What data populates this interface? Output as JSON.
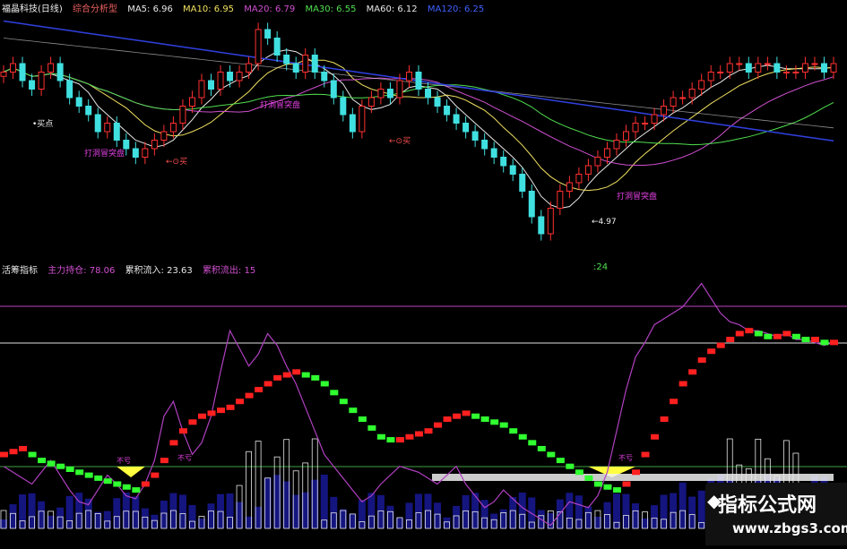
{
  "top_header": {
    "title": "福晶科技(日线)",
    "indicator": "综合分析型",
    "ma": [
      {
        "label": "MA5: 6.96",
        "color": "#e8e8e8"
      },
      {
        "label": "MA10: 6.95",
        "color": "#f0e060"
      },
      {
        "label": "MA20: 6.79",
        "color": "#d050d0"
      },
      {
        "label": "MA30: 6.55",
        "color": "#50e050"
      },
      {
        "label": "MA60: 6.12",
        "color": "#e8e8e8"
      },
      {
        "label": "MA120: 6.25",
        "color": "#4060ff"
      }
    ]
  },
  "annotations": {
    "buy_point": "买点",
    "buy": "买",
    "break_through": "打洞冒突盘",
    "low_value": "4.97"
  },
  "sub_header": {
    "name": "活筹指标",
    "main_hold": "主力持仓: 78.06",
    "inflow": "累积流入: 23.63",
    "outflow": "累积流出: 15",
    "right_value": ":24"
  },
  "labels": {
    "no_loss": "不亏"
  },
  "watermark": {
    "title": "指标公式网",
    "url": "www.zbgs3.com"
  },
  "chart_data": {
    "type": "line",
    "price_panel": {
      "x": [
        0,
        1,
        2,
        3,
        4,
        5,
        6,
        7,
        8,
        9,
        10,
        11,
        12,
        13,
        14,
        15,
        16,
        17,
        18,
        19,
        20,
        21,
        22,
        23,
        24,
        25,
        26,
        27,
        28,
        29,
        30,
        31,
        32,
        33,
        34,
        35,
        36,
        37,
        38,
        39,
        40,
        41,
        42,
        43,
        44,
        45,
        46,
        47,
        48,
        49,
        50,
        51,
        52,
        53,
        54,
        55,
        56,
        57,
        58,
        59,
        60,
        61,
        62,
        63,
        64,
        65,
        66,
        67,
        68,
        69,
        70,
        71,
        72,
        73,
        74,
        75,
        76,
        77,
        78,
        79,
        80,
        81,
        82,
        83,
        84,
        85,
        86,
        87,
        88
      ],
      "close": [
        6.9,
        7.0,
        6.8,
        6.7,
        6.9,
        7.0,
        6.8,
        6.6,
        6.5,
        6.4,
        6.2,
        6.3,
        6.1,
        6.0,
        5.9,
        6.0,
        6.1,
        6.2,
        6.3,
        6.5,
        6.6,
        6.8,
        6.7,
        6.9,
        6.8,
        6.9,
        7.0,
        7.4,
        7.3,
        7.1,
        7.0,
        6.9,
        7.1,
        6.9,
        6.8,
        6.6,
        6.4,
        6.2,
        6.5,
        6.6,
        6.7,
        6.6,
        6.8,
        6.9,
        6.7,
        6.6,
        6.5,
        6.4,
        6.3,
        6.2,
        6.1,
        6.0,
        5.9,
        5.8,
        5.7,
        5.5,
        5.2,
        5.0,
        5.3,
        5.5,
        5.6,
        5.7,
        5.8,
        5.9,
        6.0,
        6.1,
        6.2,
        6.3,
        6.3,
        6.4,
        6.5,
        6.6,
        6.6,
        6.7,
        6.8,
        6.9,
        6.9,
        7.0,
        7.0,
        6.9,
        7.0,
        7.0,
        6.9,
        6.9,
        6.9,
        7.0,
        7.0,
        6.9,
        7.0
      ],
      "ylim": [
        4.8,
        7.6
      ]
    },
    "sub_panel": {
      "red_green_line": [
        62,
        63,
        64,
        62,
        60,
        59,
        58,
        57,
        56,
        55,
        54,
        53,
        52,
        51,
        50,
        52,
        55,
        60,
        66,
        70,
        73,
        75,
        76,
        77,
        78,
        80,
        82,
        84,
        86,
        88,
        89,
        90,
        89,
        88,
        86,
        83,
        80,
        77,
        74,
        71,
        68,
        67,
        67,
        68,
        69,
        70,
        72,
        74,
        75,
        76,
        75,
        74,
        73,
        72,
        70,
        68,
        66,
        64,
        62,
        60,
        58,
        56,
        54,
        52,
        51,
        50,
        52,
        56,
        62,
        68,
        74,
        80,
        86,
        90,
        94,
        97,
        99,
        101,
        103,
        104,
        103,
        102,
        102,
        103,
        102,
        101,
        101,
        100,
        100
      ],
      "purple_line": [
        58,
        56,
        54,
        52,
        56,
        60,
        55,
        50,
        46,
        45,
        50,
        55,
        52,
        48,
        47,
        52,
        60,
        75,
        80,
        70,
        62,
        66,
        75,
        90,
        104,
        98,
        92,
        96,
        103,
        99,
        92,
        86,
        78,
        70,
        62,
        58,
        54,
        50,
        46,
        48,
        52,
        55,
        58,
        57,
        56,
        54,
        52,
        55,
        58,
        52,
        48,
        44,
        46,
        50,
        47,
        44,
        42,
        40,
        38,
        42,
        46,
        45,
        44,
        48,
        56,
        70,
        84,
        95,
        100,
        106,
        108,
        110,
        112,
        116,
        120,
        115,
        110,
        107,
        106,
        104,
        104,
        103,
        102,
        103,
        101,
        101,
        100,
        99,
        100
      ],
      "ylim": [
        40,
        125
      ]
    }
  }
}
